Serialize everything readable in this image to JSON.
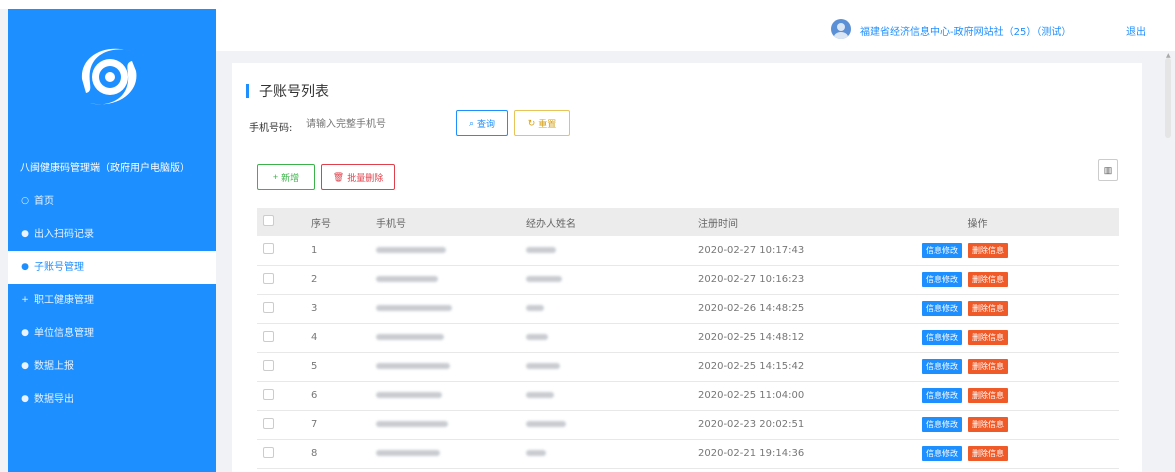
{
  "sidebar": {
    "system_title": "八闽健康码管理端（政府用户电脑版）",
    "items": [
      {
        "icon": "circle-outline",
        "label": "首页"
      },
      {
        "icon": "dot",
        "label": "出入扫码记录"
      },
      {
        "icon": "dot",
        "label": "子账号管理",
        "active": true
      },
      {
        "icon": "plus",
        "label": "职工健康管理"
      },
      {
        "icon": "dot",
        "label": "单位信息管理"
      },
      {
        "icon": "dot",
        "label": "数据上报"
      },
      {
        "icon": "dot",
        "label": "数据导出"
      }
    ]
  },
  "header": {
    "user_name": "福建省经济信息中心-政府网站社（25）（测试）",
    "logout_label": "退出"
  },
  "page": {
    "title": "子账号列表",
    "search_label": "手机号码:",
    "search_placeholder": "请输入完整手机号",
    "query_label": "查询",
    "reset_label": "重置",
    "add_label": "新增",
    "batch_delete_label": "批量删除"
  },
  "table": {
    "headers": [
      "序号",
      "手机号",
      "经办人姓名",
      "注册时间",
      "操作"
    ],
    "edit_label": "信息修改",
    "delete_label": "删除信息",
    "rows": [
      {
        "no": "1",
        "time": "2020-02-27 10:17:43"
      },
      {
        "no": "2",
        "time": "2020-02-27 10:16:23"
      },
      {
        "no": "3",
        "time": "2020-02-26 14:48:25"
      },
      {
        "no": "4",
        "time": "2020-02-25 14:48:12"
      },
      {
        "no": "5",
        "time": "2020-02-25 14:15:42"
      },
      {
        "no": "6",
        "time": "2020-02-25 11:04:00"
      },
      {
        "no": "7",
        "time": "2020-02-23 20:02:51"
      },
      {
        "no": "8",
        "time": "2020-02-21 19:14:36"
      }
    ]
  },
  "colors": {
    "primary": "#1e8fff",
    "danger": "#f05a28",
    "success": "#3cb34a",
    "warning": "#d4a017"
  }
}
